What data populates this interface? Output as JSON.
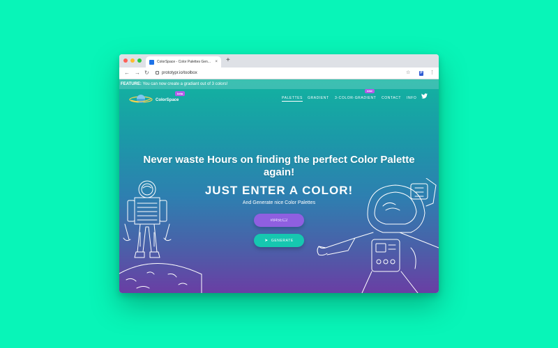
{
  "browser": {
    "tab_title": "ColorSpace - Color Palettes Gen...",
    "new_tab": "+",
    "tab_close": "×",
    "url": "prototypr.io/toolbox",
    "back": "←",
    "forward": "→",
    "reload": "↻",
    "star": "☆",
    "menu": "⋮",
    "ext_label": "P"
  },
  "banner": {
    "label": "FEATURE:",
    "text": " You can now create a gradiant out of 3 colors!"
  },
  "site": {
    "logo_text": "ColorSpace",
    "beta": "beta",
    "nav": [
      "PALETTES",
      "GRADIENT",
      "3-COLOR-GRADIENT",
      "CONTACT",
      "INFO"
    ],
    "new_badge": "new",
    "twitter_icon": "twitter-icon"
  },
  "hero": {
    "headline": "Never waste Hours on finding the perfect Color Palette again!",
    "subhead": "JUST ENTER A COLOR!",
    "tagline": "And Generate nice Color Palettes",
    "input_value": "#845EC2",
    "generate_label": "GENERATE",
    "generate_icon": "rocket-icon"
  },
  "colors": {
    "page_bg": "#08f5b8",
    "gradient_top": "#12b3a0",
    "gradient_bottom": "#6a3ea4",
    "input_bg": "#8f5fe0",
    "button_bg": "#16c7b0",
    "badge": "#b45ce8"
  }
}
